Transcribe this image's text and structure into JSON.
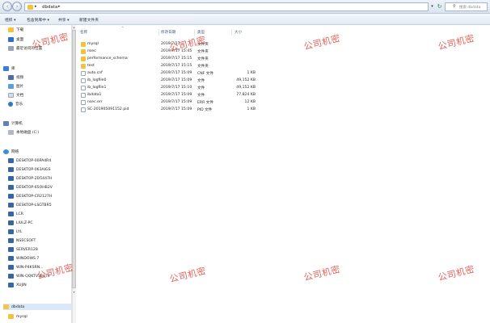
{
  "address_bar": {
    "path_segment": "dbdata",
    "search_placeholder": "搜索 dbdata"
  },
  "toolbar": {
    "organize": "组织 ▾",
    "include_in_library": "包含到库中 ▾",
    "share": "共享 ▾",
    "new_folder": "新建文件夹"
  },
  "nav": {
    "favorites": [
      {
        "label": "下载",
        "icon": "download-folder-icon"
      },
      {
        "label": "桌面",
        "icon": "desktop-icon"
      },
      {
        "label": "最近访问的位置",
        "icon": "recent-places-icon"
      }
    ],
    "libraries_header": "库",
    "libraries": [
      {
        "label": "视频",
        "icon": "video-library-icon"
      },
      {
        "label": "图片",
        "icon": "picture-library-icon"
      },
      {
        "label": "文档",
        "icon": "document-library-icon"
      },
      {
        "label": "音乐",
        "icon": "music-library-icon"
      }
    ],
    "computer_header": "计算机",
    "computer_items": [
      {
        "label": "本地磁盘 (C:)",
        "icon": "local-disk-icon"
      }
    ],
    "network_header": "网络",
    "network_items": [
      {
        "label": "DESKTOP-00PA4R4"
      },
      {
        "label": "DESKTOP-063AIGS"
      },
      {
        "label": "DESKTOP-2D5447H"
      },
      {
        "label": "DESKTOP-65OHB2V"
      },
      {
        "label": "DESKTOP-CR2127H"
      },
      {
        "label": "DESKTOP-LSGTBR5"
      },
      {
        "label": "LCR"
      },
      {
        "label": "LIULZ-PC"
      },
      {
        "label": "LYL"
      },
      {
        "label": "NSECSOFT"
      },
      {
        "label": "SERVER128"
      },
      {
        "label": "WINDOWS 7"
      },
      {
        "label": "WIN-P4KSRN..."
      },
      {
        "label": "WIN-QQKTV383TV"
      },
      {
        "label": "XUJIN"
      }
    ],
    "tree_items": [
      {
        "label": "dbdata"
      },
      {
        "label": "mysql"
      }
    ]
  },
  "list": {
    "columns": {
      "name": "名称",
      "modified": "修改日期",
      "type": "类型",
      "size": "大小"
    },
    "rows": [
      {
        "name": "mysql",
        "modified": "2019/7/17 ...",
        "type": "文件夹",
        "size": "",
        "kind": "dir"
      },
      {
        "name": "nsec",
        "modified": "2019/7/17 15:45",
        "type": "文件夹",
        "size": "",
        "kind": "dir"
      },
      {
        "name": "performance_schema",
        "modified": "2019/7/17 15:15",
        "type": "文件夹",
        "size": "",
        "kind": "dir"
      },
      {
        "name": "test",
        "modified": "2019/7/17 15:15",
        "type": "文件夹",
        "size": "",
        "kind": "dir"
      },
      {
        "name": "auto.cnf",
        "modified": "2019/7/17 15:09",
        "type": "CNF 文件",
        "size": "1 KB",
        "kind": "file"
      },
      {
        "name": "ib_logfile0",
        "modified": "2019/7/17 15:09",
        "type": "文件",
        "size": "49,152 KB",
        "kind": "file"
      },
      {
        "name": "ib_logfile1",
        "modified": "2019/7/17 15:10",
        "type": "文件",
        "size": "49,152 KB",
        "kind": "file"
      },
      {
        "name": "ibdata1",
        "modified": "2019/7/17 15:09",
        "type": "文件",
        "size": "77,824 KB",
        "kind": "file"
      },
      {
        "name": "nsec.err",
        "modified": "2019/7/17 15:09",
        "type": "ERR 文件",
        "size": "12 KB",
        "kind": "file"
      },
      {
        "name": "SC-201905091152.pid",
        "modified": "2019/7/17 15:09",
        "type": "PID 文件",
        "size": "1 KB",
        "kind": "file"
      }
    ]
  },
  "watermark": "公司机密"
}
